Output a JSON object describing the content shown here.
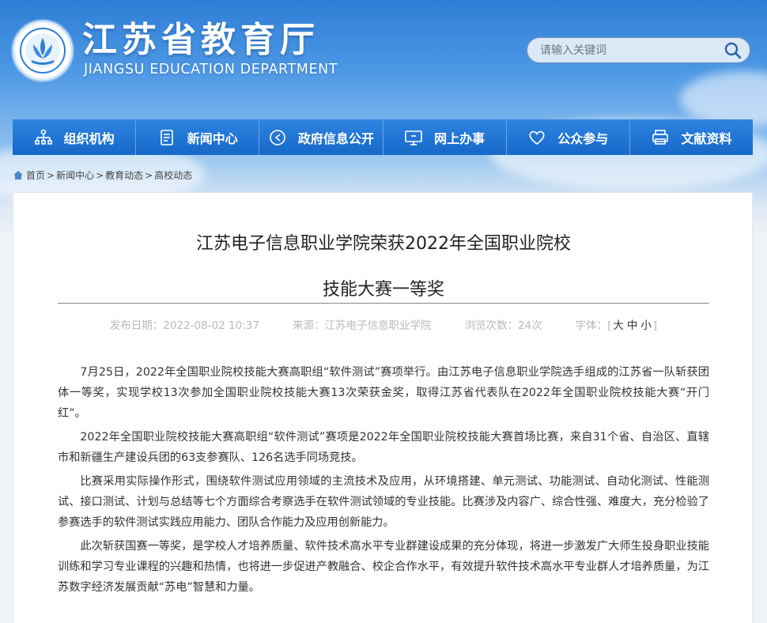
{
  "site": {
    "title_cn": "江苏省教育厅",
    "title_en": "JIANGSU EDUCATION DEPARTMENT"
  },
  "search": {
    "placeholder": "请输入关键词",
    "icon": "search-icon"
  },
  "nav": {
    "items": [
      {
        "label": "组织机构",
        "icon": "org-chart-icon"
      },
      {
        "label": "新闻中心",
        "icon": "document-icon"
      },
      {
        "label": "政府信息公开",
        "icon": "announcement-icon"
      },
      {
        "label": "网上办事",
        "icon": "monitor-icon"
      },
      {
        "label": "公众参与",
        "icon": "heart-icon"
      },
      {
        "label": "文献资料",
        "icon": "printer-icon"
      }
    ]
  },
  "breadcrumb": {
    "icon": "home-icon",
    "items": [
      "首页",
      "新闻中心",
      "教育动态",
      "高校动态"
    ]
  },
  "article": {
    "title_line1": "江苏电子信息职业学院荣获2022年全国职业院校",
    "title_line2": "技能大赛一等奖",
    "meta": {
      "date_label": "发布日期：",
      "date": "2022-08-02 10:37",
      "source_label": "来源：",
      "source": "江苏电子信息职业学院",
      "views_label": "浏览次数：",
      "views": "24次",
      "font_label": "字体：[",
      "font_large": "大",
      "font_medium": "中",
      "font_small": "小",
      "font_close": "]"
    },
    "paragraphs": [
      "7月25日，2022年全国职业院校技能大赛高职组“软件测试”赛项举行。由江苏电子信息职业学院选手组成的江苏省一队斩获团体一等奖，实现学校13次参加全国职业院校技能大赛13次荣获金奖，取得江苏省代表队在2022年全国职业院校技能大赛“开门红”。",
      "2022年全国职业院校技能大赛高职组“软件测试”赛项是2022年全国职业院校技能大赛首场比赛，来自31个省、自治区、直辖市和新疆生产建设兵团的63支参赛队、126名选手同场竞技。",
      "比赛采用实际操作形式，围绕软件测试应用领域的主流技术及应用，从环境搭建、单元测试、功能测试、自动化测试、性能测试、接口测试、计划与总结等七个方面综合考察选手在软件测试领域的专业技能。比赛涉及内容广、综合性强、难度大，充分检验了参赛选手的软件测试实践应用能力、团队合作能力及应用创新能力。",
      "此次斩获国赛一等奖，是学校人才培养质量、软件技术高水平专业群建设成果的充分体现，将进一步激发广大师生投身职业技能训练和学习专业课程的兴趣和热情，也将进一步促进产教融合、校企合作水平，有效提升软件技术高水平专业群人才培养质量，为江苏数字经济发展贡献“苏电”智慧和力量。"
    ]
  },
  "colors": {
    "nav_bg": "#1a6fd0",
    "header_top": "#2f7ed6"
  }
}
